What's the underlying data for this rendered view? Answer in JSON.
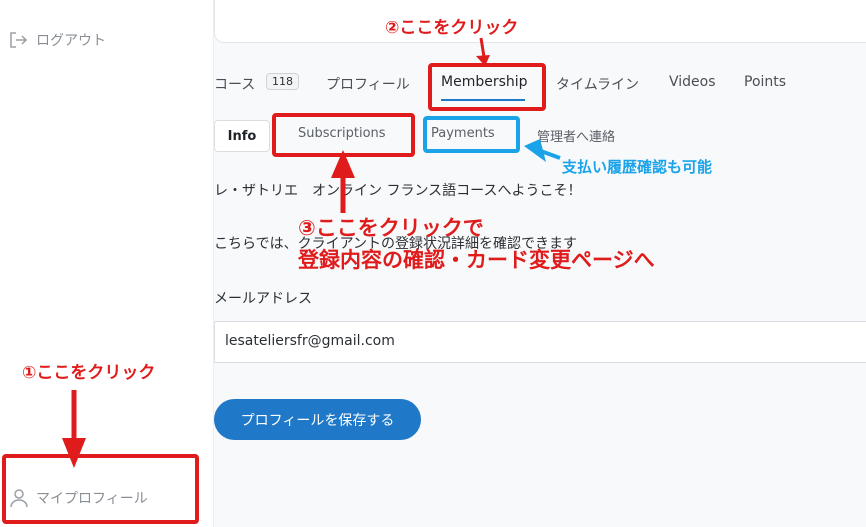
{
  "sidebar": {
    "logout_label": "ログアウト",
    "my_profile_label": "マイプロフィール"
  },
  "tabs": [
    {
      "label": "コース",
      "badge": "118"
    },
    {
      "label": "プロフィール"
    },
    {
      "label": "Membership",
      "active": true
    },
    {
      "label": "タイムライン"
    },
    {
      "label": "Videos"
    },
    {
      "label": "Points"
    }
  ],
  "subtabs": [
    {
      "label": "Info",
      "active": true
    },
    {
      "label": "Subscriptions"
    },
    {
      "label": "Payments"
    },
    {
      "label": "管理者へ連絡"
    }
  ],
  "content": {
    "welcome": "レ・ザトリエ　オンライン フランス語コースへようこそ！",
    "hint": "こちらでは、クライアントの登録状況詳細を確認できます",
    "email_label": "メールアドレス",
    "email_value": "lesateliersfr@gmail.com",
    "save_button": "プロフィールを保存する"
  },
  "annotations": {
    "step1": "①ここをクリック",
    "step2": "②ここをクリック",
    "step3_line1": "③ここをクリックで",
    "step3_line2": "登録内容の確認・カード変更ページへ",
    "payments_note": "支払い履歴確認も可能"
  },
  "colors": {
    "accent": "#1f78c8",
    "annotation_red": "#e01b1b",
    "annotation_blue": "#1aa3e8"
  }
}
